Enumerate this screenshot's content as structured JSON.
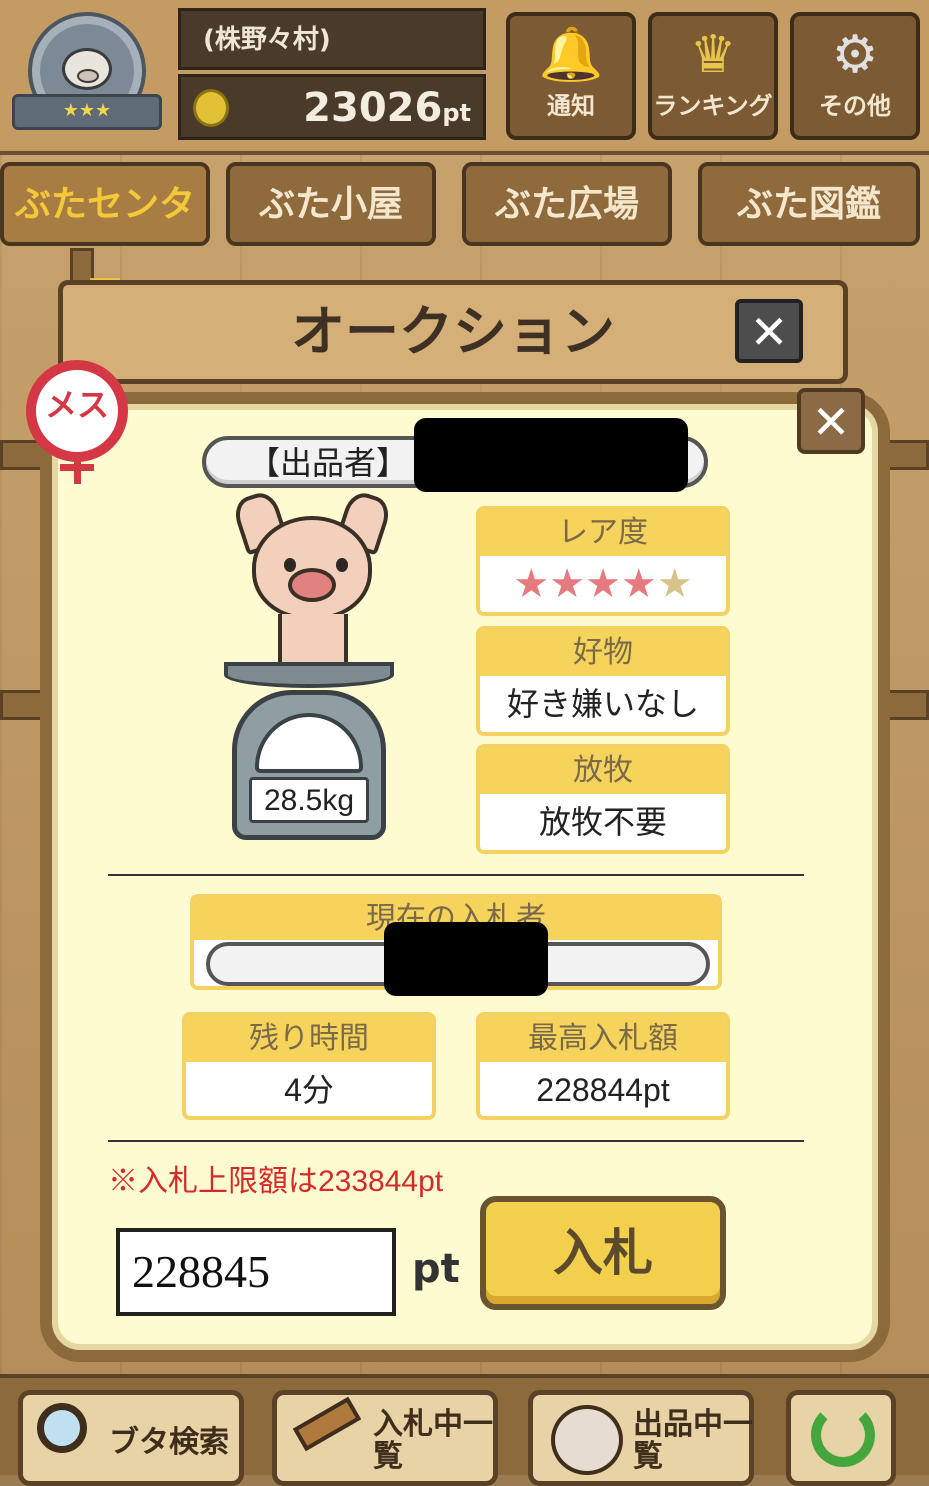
{
  "header": {
    "user_name": "(株野々村)",
    "points_value": "23026",
    "points_unit": "pt",
    "buttons": [
      {
        "label": "通知",
        "icon": "bell-icon",
        "glyph": "🔔"
      },
      {
        "label": "ランキング",
        "icon": "crown-icon",
        "glyph": "♛"
      },
      {
        "label": "その他",
        "icon": "gear-icon",
        "glyph": "⚙"
      }
    ],
    "rank_stars": "★★★"
  },
  "tabs": [
    {
      "label": "ぶたセンター"
    },
    {
      "label": "ぶた小屋"
    },
    {
      "label": "ぶた広場"
    },
    {
      "label": "ぶた図鑑"
    }
  ],
  "auction": {
    "title": "オークション",
    "close_glyph": "✕"
  },
  "panel": {
    "gender_label": "メス",
    "close_glyph": "✕",
    "seller_label": "【出品者】",
    "weight": "28.5kg",
    "rarity": {
      "title": "レア度",
      "filled_stars": 4,
      "total_stars": 5
    },
    "favorite": {
      "title": "好物",
      "value": "好き嫌いなし"
    },
    "grazing": {
      "title": "放牧",
      "value": "放牧不要"
    },
    "current_bidder_title": "現在の入札者",
    "remaining": {
      "title": "残り時間",
      "value": "4分"
    },
    "highest_bid": {
      "title": "最高入札額",
      "value": "228844pt"
    },
    "limit_note": "※入札上限額は233844pt",
    "bid_input_value": "228845",
    "bid_unit": "pt",
    "bid_button": "入札"
  },
  "bottom_nav": [
    {
      "label": "ブタ検索",
      "icon": "magnifier-icon"
    },
    {
      "label": "入札中一覧",
      "icon": "gavel-icon"
    },
    {
      "label": "出品中一覧",
      "icon": "pig-face-icon"
    },
    {
      "label": "",
      "icon": "refresh-icon"
    }
  ],
  "colors": {
    "accent_yellow": "#f6d45c",
    "female_red": "#d33844",
    "limit_red": "#d42a2a"
  }
}
